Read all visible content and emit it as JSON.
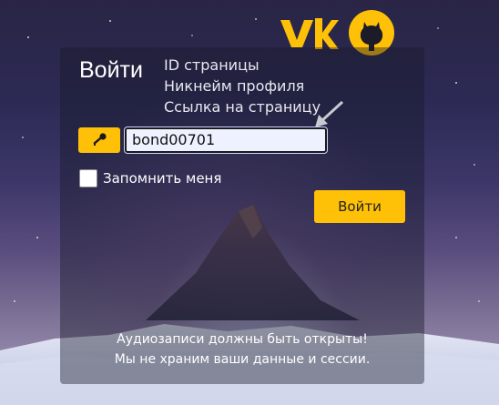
{
  "login": {
    "title": "Войти",
    "hints": [
      "ID страницы",
      "Никнейм профиля",
      "Ссылка на страницу"
    ],
    "input_value": "bond00701",
    "remember_label": "Запомнить меня",
    "submit_label": "Войти"
  },
  "notice": {
    "line1": "Аудиозаписи должны быть открыты!",
    "line2": "Мы не храним ваши данные и сессии."
  },
  "colors": {
    "accent": "#ffc107"
  },
  "icons": {
    "vk": "vk-logo-icon",
    "github": "github-icon",
    "key": "key-icon",
    "arrow": "pointer-arrow-icon"
  }
}
